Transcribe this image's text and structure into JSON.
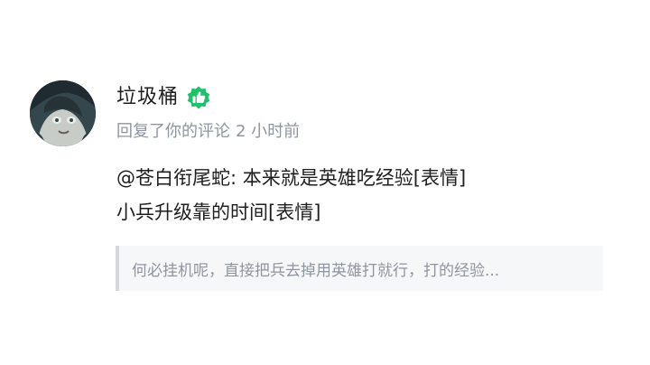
{
  "user": {
    "name": "垃圾桶",
    "badge_icon": "thumbs-up-badge-icon",
    "badge_color": "#1fc26b"
  },
  "meta": {
    "action": "回复了你的评论",
    "time": "2 小时前"
  },
  "comment": {
    "line1": "@苍白衔尾蛇: 本来就是英雄吃经验[表情]",
    "line2": "小兵升级靠的时间[表情]"
  },
  "quote": {
    "text": "何必挂机呢，直接把兵去掉用英雄打就行，打的经验..."
  }
}
